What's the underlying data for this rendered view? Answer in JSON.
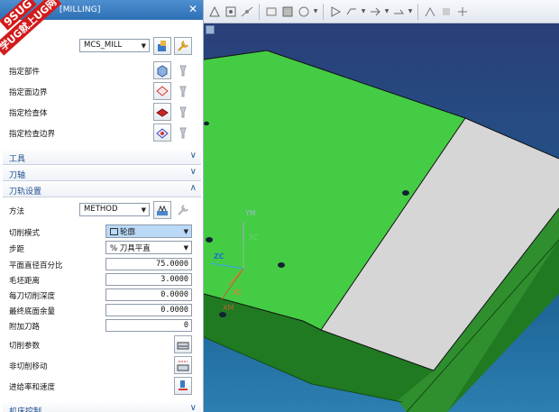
{
  "window": {
    "title": "[MILLING]",
    "close_icon": "close-icon"
  },
  "watermark": {
    "line1": "9SUG",
    "line2": "学UG就上UG网"
  },
  "geometry": {
    "geometry_select": "MCS_MILL",
    "rows": [
      {
        "label": "指定部件",
        "icon": "part-icon"
      },
      {
        "label": "指定面边界",
        "icon": "face-boundary-icon"
      },
      {
        "label": "指定检查体",
        "icon": "check-body-icon"
      },
      {
        "label": "指定检查边界",
        "icon": "check-boundary-icon"
      }
    ]
  },
  "sections": {
    "tool": "工具",
    "axis": "刀轴",
    "path_settings": "刀轨设置",
    "machine_control": "机床控制"
  },
  "path": {
    "method_label": "方法",
    "method_value": "METHOD",
    "cut_mode_label": "切削模式",
    "cut_mode_value": "轮廓",
    "stepover_label": "步距",
    "stepover_value": "% 刀具平直",
    "pct_label": "平面直径百分比",
    "pct_value": "75.0000",
    "blank_label": "毛坯距离",
    "blank_value": "3.0000",
    "depth_label": "每刀切削深度",
    "depth_value": "0.0000",
    "floor_label": "最终底面余量",
    "floor_value": "0.0000",
    "extra_label": "附加刀路",
    "extra_value": "0",
    "cut_params_label": "切削参数",
    "noncut_label": "非切削移动",
    "feeds_label": "进给率和速度"
  },
  "axes": {
    "ym": "YM",
    "yc": "YC",
    "zc": "ZC",
    "xc": "XC",
    "xm": "XM"
  },
  "colors": {
    "green_face": "#45cc45",
    "gray_face": "#d6d6d6",
    "bg_top": "#2a3f78",
    "bg_bottom": "#2c7fb0"
  }
}
